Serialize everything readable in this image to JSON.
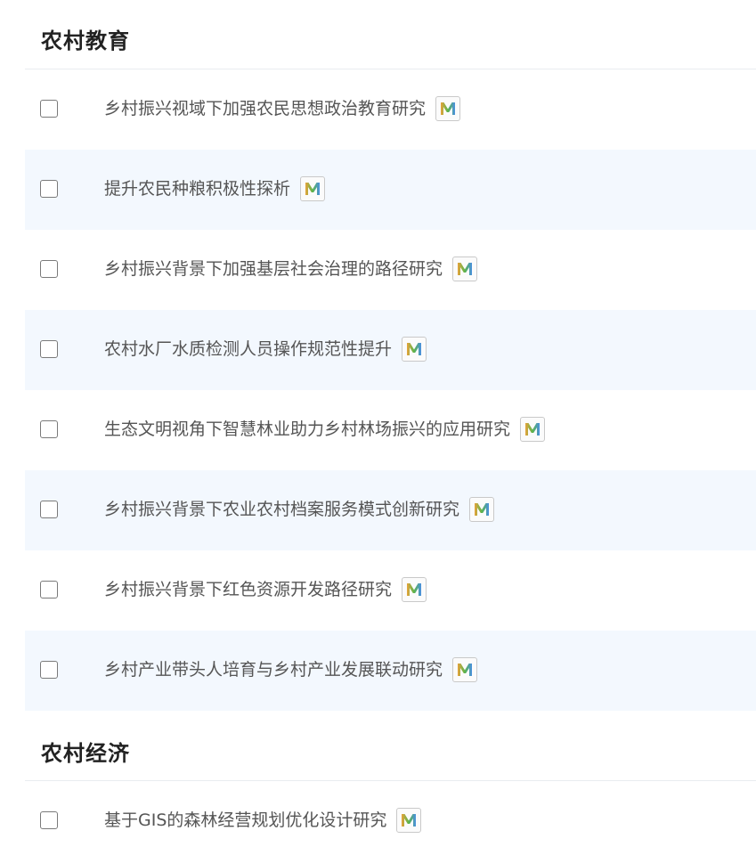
{
  "sections": [
    {
      "title": "农村教育",
      "items": [
        {
          "title": "乡村振兴视域下加强农民思想政治教育研究",
          "badge_icon": "m-color-badge-icon",
          "checked": false
        },
        {
          "title": "提升农民种粮积极性探析",
          "badge_icon": "m-color-badge-icon",
          "checked": false
        },
        {
          "title": "乡村振兴背景下加强基层社会治理的路径研究",
          "badge_icon": "m-color-badge-icon",
          "checked": false
        },
        {
          "title": "农村水厂水质检测人员操作规范性提升",
          "badge_icon": "m-color-badge-icon",
          "checked": false
        },
        {
          "title": "生态文明视角下智慧林业助力乡村林场振兴的应用研究",
          "badge_icon": "m-color-badge-icon",
          "checked": false
        },
        {
          "title": "乡村振兴背景下农业农村档案服务模式创新研究",
          "badge_icon": "m-color-badge-icon",
          "checked": false
        },
        {
          "title": "乡村振兴背景下红色资源开发路径研究",
          "badge_icon": "m-color-badge-icon",
          "checked": false
        },
        {
          "title": "乡村产业带头人培育与乡村产业发展联动研究",
          "badge_icon": "m-color-badge-icon",
          "checked": false
        }
      ]
    },
    {
      "title": "农村经济",
      "items": [
        {
          "title": "基于GIS的森林经营规划优化设计研究",
          "badge_icon": "m-color-badge-icon",
          "checked": false
        }
      ]
    }
  ],
  "colors": {
    "alt_row_background": "#f3f8fe",
    "divider": "#e9ecf0",
    "title_text": "#555555",
    "section_text": "#222222",
    "badge_m_left": "#e8a33a",
    "badge_m_mid": "#5bb54a",
    "badge_m_right": "#4a90e2"
  }
}
